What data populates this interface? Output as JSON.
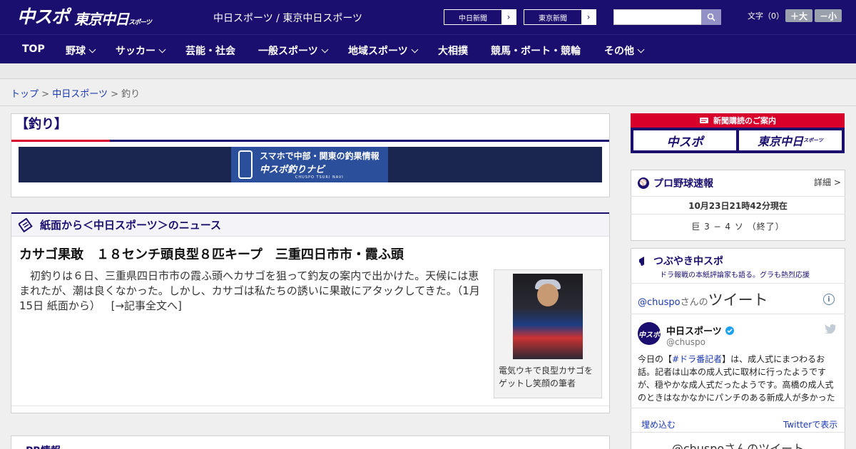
{
  "header": {
    "logo_main": "中スポ",
    "logo_sub": "東京中日",
    "logo_sub_small": "スポーツ",
    "site_name": "中日スポーツ / 東京中日スポーツ",
    "ext_links": [
      {
        "label": "中日新聞"
      },
      {
        "label": "東京新聞"
      }
    ],
    "search_placeholder": "",
    "fontsize_label": "文字（0）",
    "font_larger": "＋大",
    "font_smaller": "－小"
  },
  "nav": {
    "items": [
      {
        "label": "TOP",
        "dropdown": false
      },
      {
        "label": "野球",
        "dropdown": true
      },
      {
        "label": "サッカー",
        "dropdown": true
      },
      {
        "label": "芸能・社会",
        "dropdown": false
      },
      {
        "label": "一般スポーツ",
        "dropdown": true
      },
      {
        "label": "地域スポーツ",
        "dropdown": true
      },
      {
        "label": "大相撲",
        "dropdown": false
      },
      {
        "label": "競馬・ボート・競輪",
        "dropdown": false
      },
      {
        "label": "その他",
        "dropdown": true
      }
    ]
  },
  "breadcrumb": {
    "items": [
      "トップ",
      "中日スポーツ",
      "釣り"
    ],
    "separator": ">"
  },
  "category": {
    "title": "【釣り】"
  },
  "banner": {
    "line1": "スマホで中部・関東の釣果情報",
    "line2": "中スポ釣りナビ",
    "line3": "CHUSPO TSURI NAVI"
  },
  "news_section": {
    "heading": "紙面から＜中日スポーツ＞のニュース",
    "article": {
      "title": "カサゴ果敢　１８センチ頭良型８匹キープ　三重四日市市・霞ふ頭",
      "body": "　初釣りは６日、三重県四日市市の霞ふ頭へカサゴを狙って釣友の案内で出かけた。天候には恵まれたが、潮は良くなかった。しかし、カサゴは私たちの誘いに果敢にアタックしてきた。（1月15日 紙面から）",
      "more_link": "[→記事全文へ]",
      "photo_caption": "電気ウキで良型カサゴをゲットし笑顔の筆者"
    }
  },
  "pr": {
    "heading": "PR情報"
  },
  "sidebar": {
    "subscribe": {
      "heading": "新聞購読のご案内",
      "left": "中スポ",
      "right": "東京中日",
      "right_small": "スポーツ"
    },
    "baseball": {
      "title": "プロ野球速報",
      "detail": "詳細 >",
      "updated": "10月23日21時42分現在",
      "score": "巨 3 − 4 ソ （終了）"
    },
    "twitter": {
      "title": "つぶやき中スポ",
      "subtitle": "ドラ報戦の本紙評論家も語る。グラも熱烈応援",
      "tweets_header_handle": "@chuspo",
      "tweets_header_suffix": "さんの",
      "tweets_header_main": "ツイート",
      "account_name": "中日スポーツ",
      "account_handle": "@chuspo",
      "tweet_pre": "今日の【",
      "tweet_hashtag": "#ドラ番記者",
      "tweet_post": "】は、成人式にまつわるお話。記者は山本の成人式に取材に行ったようですが、穏やかな成人式だったようです。高橋の成人式のときはなかなかにパンチのある新成人が多かった",
      "embed": "埋め込む",
      "view_on_twitter": "Twitterで表示",
      "footer": "@chuspoさんのツイート",
      "avatar_text": "中スポ"
    }
  },
  "colors": {
    "brand_navy": "#1a0f6e",
    "accent_red": "#d8002a",
    "link_blue": "#1a38b0"
  }
}
